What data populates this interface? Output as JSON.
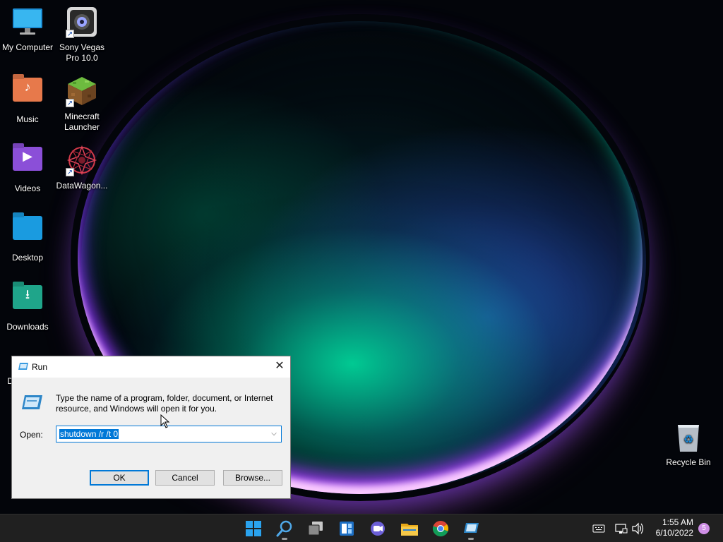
{
  "desktop": {
    "icons": [
      {
        "label_line1": "My Computer",
        "label_line2": "",
        "icon": "monitor-icon",
        "shortcut": false
      },
      {
        "label_line1": "Sony Vegas",
        "label_line2": "Pro 10.0",
        "icon": "sony-vegas-icon",
        "shortcut": true
      },
      {
        "label_line1": "Music",
        "label_line2": "",
        "icon": "music-folder-icon",
        "shortcut": false
      },
      {
        "label_line1": "Minecraft",
        "label_line2": "Launcher",
        "icon": "minecraft-icon",
        "shortcut": true
      },
      {
        "label_line1": "Videos",
        "label_line2": "",
        "icon": "videos-folder-icon",
        "shortcut": false
      },
      {
        "label_line1": "DataWagon...",
        "label_line2": "",
        "icon": "datawagon-icon",
        "shortcut": true
      },
      {
        "label_line1": "Desktop",
        "label_line2": "",
        "icon": "desktop-folder-icon",
        "shortcut": false
      },
      {
        "label_line1": "Downloads",
        "label_line2": "",
        "icon": "downloads-folder-icon",
        "shortcut": false
      },
      {
        "label_line1": "D",
        "label_line2": "",
        "icon": "partial-icon",
        "shortcut": false
      },
      {
        "label_line1": "Recycle Bin",
        "label_line2": "",
        "icon": "recycle-bin-icon",
        "shortcut": false
      }
    ]
  },
  "run_dialog": {
    "title": "Run",
    "close_symbol": "✕",
    "description": "Type the name of a program, folder, document, or Internet resource, and Windows will open it for you.",
    "open_label": "Open:",
    "command_value": "shutdown /r /t 0",
    "buttons": {
      "ok": "OK",
      "cancel": "Cancel",
      "browse": "Browse..."
    }
  },
  "taskbar": {
    "apps": [
      "start-icon",
      "search-icon",
      "task-view-icon",
      "widgets-icon",
      "chat-icon",
      "file-explorer-icon",
      "chrome-icon",
      "run-app-icon"
    ],
    "tray_icons": [
      "keyboard-icon",
      "network-icon",
      "volume-icon"
    ],
    "time": "1:55 AM",
    "date": "6/10/2022",
    "notification_count": "5"
  },
  "colors": {
    "accent": "#0078d7",
    "taskbar_bg": "#202020",
    "notification_badge": "#cf8fe6"
  }
}
